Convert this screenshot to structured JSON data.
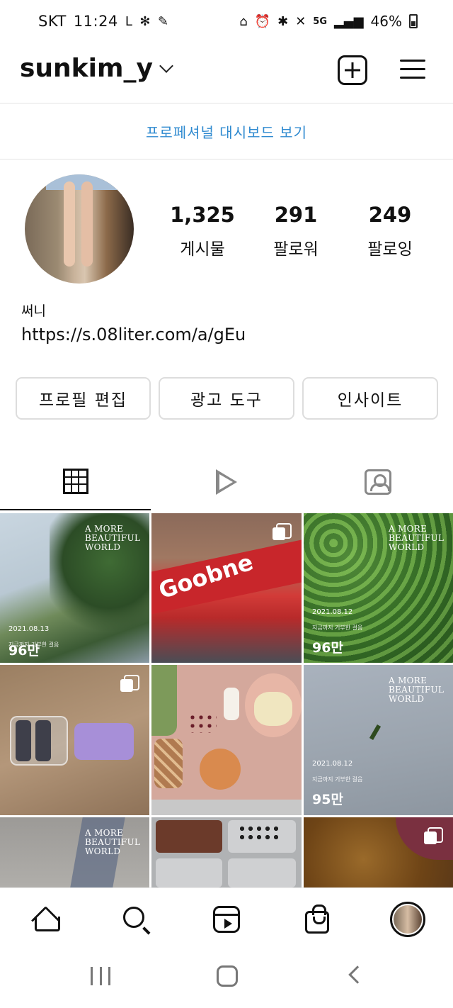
{
  "status_bar": {
    "carrier": "SKT",
    "time": "11:24",
    "left_icons": [
      "l-app-icon",
      "pinwheel-icon",
      "feather-icon"
    ],
    "right_icons": [
      "lock-icon",
      "alarm-icon",
      "bluetooth-icon",
      "mute-icon",
      "5g-icon",
      "signal-icon"
    ],
    "network": "5G",
    "battery": "46%",
    "battery_level": 0.46
  },
  "header": {
    "username": "sunkim_y",
    "icons": [
      "chevron-down-icon",
      "new-post-icon",
      "menu-icon"
    ]
  },
  "dashboard": {
    "label": "프로페셔널 대시보드 보기",
    "accent": "#2f8ad0"
  },
  "profile": {
    "stats": [
      {
        "value": "1,325",
        "label": "게시물"
      },
      {
        "value": "291",
        "label": "팔로워"
      },
      {
        "value": "249",
        "label": "팔로잉"
      }
    ],
    "name": "써니",
    "link": "https://s.08liter.com/a/gEu"
  },
  "buttons": {
    "edit_profile": "프로필 편집",
    "ad_tools": "광고 도구",
    "insights": "인사이트"
  },
  "tabs": [
    {
      "name": "posts",
      "icon": "grid-icon",
      "active": true
    },
    {
      "name": "reels",
      "icon": "play-icon",
      "active": false
    },
    {
      "name": "tagged",
      "icon": "tag-icon",
      "active": false
    }
  ],
  "posts": [
    {
      "brand": "A MORE BEAUTIFUL WORLD",
      "date": "2021.08.13",
      "caption": "지금까지 기부한 걸음",
      "views": "96만",
      "multi": false
    },
    {
      "brand": "",
      "sign_text": "Goobne",
      "multi": true
    },
    {
      "brand": "A MORE BEAUTIFUL WORLD",
      "date": "2021.08.12",
      "caption": "지금까지 기부한 걸음",
      "views": "96만",
      "multi": false
    },
    {
      "brand": "",
      "multi": true
    },
    {
      "brand": "",
      "multi": false
    },
    {
      "brand": "A MORE BEAUTIFUL WORLD",
      "date": "2021.08.12",
      "caption": "지금까지 기부한 걸음",
      "views": "95만",
      "multi": false
    },
    {
      "brand": "A MORE BEAUTIFUL WORLD",
      "multi": false
    },
    {
      "brand": "",
      "multi": false
    },
    {
      "brand": "",
      "multi": true
    }
  ],
  "bottom_nav": [
    "home-icon",
    "search-icon",
    "reels-icon",
    "shop-icon",
    "profile-avatar"
  ],
  "system_nav": [
    "recents-button",
    "home-button",
    "back-button"
  ]
}
